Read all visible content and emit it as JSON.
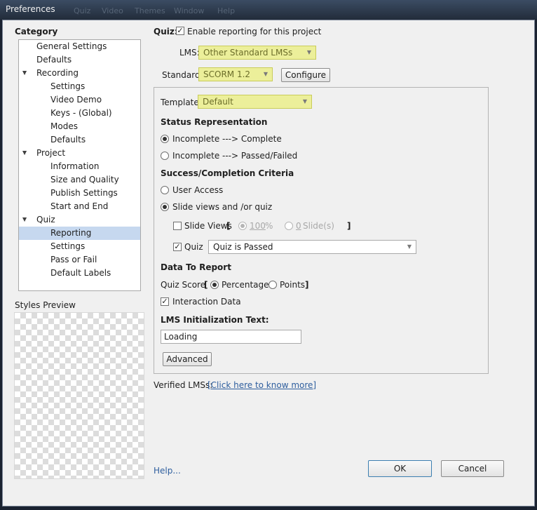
{
  "window": {
    "title": "Preferences",
    "background_menu": [
      "Quiz",
      "Video",
      "Themes",
      "Window",
      "Help"
    ]
  },
  "sidebar": {
    "heading": "Category",
    "items": [
      {
        "label": "General Settings",
        "level": 1
      },
      {
        "label": "Defaults",
        "level": 1
      },
      {
        "label": "Recording",
        "level": 1,
        "expander": "▲"
      },
      {
        "label": "Settings",
        "level": 2
      },
      {
        "label": "Video Demo",
        "level": 2
      },
      {
        "label": "Keys - (Global)",
        "level": 2
      },
      {
        "label": "Modes",
        "level": 2
      },
      {
        "label": "Defaults",
        "level": 2
      },
      {
        "label": "Project",
        "level": 1,
        "expander": "▲"
      },
      {
        "label": "Information",
        "level": 2
      },
      {
        "label": "Size and Quality",
        "level": 2
      },
      {
        "label": "Publish Settings",
        "level": 2
      },
      {
        "label": "Start and End",
        "level": 2
      },
      {
        "label": "Quiz",
        "level": 1,
        "expander": "▲"
      },
      {
        "label": "Reporting",
        "level": 2,
        "selected": true
      },
      {
        "label": "Settings",
        "level": 2
      },
      {
        "label": "Pass or Fail",
        "level": 2
      },
      {
        "label": "Default Labels",
        "level": 2
      }
    ],
    "styles_preview_label": "Styles Preview"
  },
  "main": {
    "quiz_label": "Quiz:",
    "enable_reporting": {
      "label": "Enable reporting for this project",
      "checked": true
    },
    "lms": {
      "label": "LMS:",
      "value": "Other Standard LMSs"
    },
    "standard": {
      "label": "Standard:",
      "value": "SCORM 1.2"
    },
    "configure_button": "Configure",
    "template": {
      "label": "Template:",
      "value": "Default"
    },
    "status_representation": {
      "heading": "Status Representation",
      "options": [
        {
          "label": "Incomplete ---> Complete",
          "selected": true
        },
        {
          "label": "Incomplete ---> Passed/Failed",
          "selected": false
        }
      ]
    },
    "success_criteria": {
      "heading": "Success/Completion Criteria",
      "user_access": "User Access",
      "slide_views_quiz": "Slide views and /or quiz",
      "slide_views": {
        "label": "Slide Views",
        "open_bracket": "[",
        "close_bracket": "]",
        "percent_value": "100",
        "percent_unit": "%",
        "slides_value": "0",
        "slides_unit": "Slide(s)"
      },
      "quiz": {
        "label": "Quiz",
        "value": "Quiz is Passed"
      }
    },
    "data_to_report": {
      "heading": "Data To Report",
      "quiz_score_label": "Quiz Score",
      "open_bracket": "[",
      "close_bracket": "]",
      "percentage": "Percentage",
      "points": "Points",
      "interaction_data": "Interaction Data"
    },
    "lms_init": {
      "heading": "LMS Initialization Text:",
      "value": "Loading"
    },
    "advanced_button": "Advanced",
    "verified_lms": {
      "label": "Verified LMSs:",
      "link": "[Click here to know more]"
    }
  },
  "footer": {
    "help": "Help...",
    "ok": "OK",
    "cancel": "Cancel"
  },
  "icons": {
    "check": "✓",
    "dropdown": "▼"
  },
  "colors": {
    "highlight": "#ecef9a",
    "selection": "#c6d8ef",
    "titlebar": "#2b3749"
  }
}
